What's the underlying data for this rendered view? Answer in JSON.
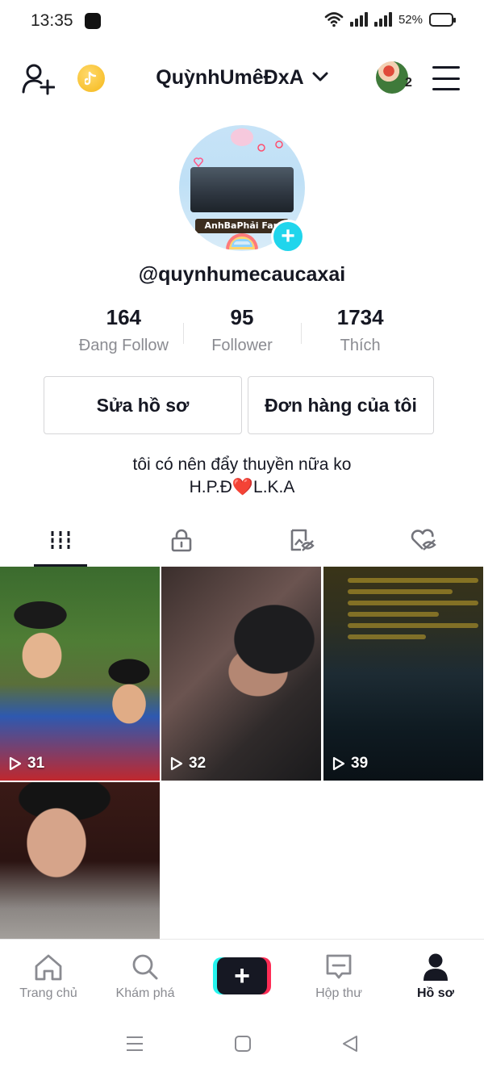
{
  "status_bar": {
    "time": "13:35",
    "battery_text": "52%",
    "battery_level": 0.52,
    "icons": [
      "app-notification-icon",
      "wifi-icon",
      "signal-icon",
      "signal-icon",
      "battery-icon"
    ]
  },
  "top_nav": {
    "username": "QuỳnhUmêĐxA",
    "friend_avatar_count": "2",
    "icons": [
      "add-friend-icon",
      "coin-icon",
      "chevron-down-icon",
      "friend-avatar",
      "menu-icon"
    ]
  },
  "profile": {
    "handle": "@quynhumecaucaxai",
    "avatar_banner_text": "AnhBaPhải Fan",
    "stats": [
      {
        "value": "164",
        "label": "Đang Follow"
      },
      {
        "value": "95",
        "label": "Follower"
      },
      {
        "value": "1734",
        "label": "Thích"
      }
    ],
    "buttons": {
      "edit_profile": "Sửa hồ sơ",
      "my_orders": "Đơn hàng của tôi"
    },
    "bio_line1": "tôi có nên đẩy thuyền nữa ko",
    "bio_line2": "H.P.Đ❤️L.K.A"
  },
  "content_tabs": [
    "grid-icon",
    "lock-icon",
    "tagged-hidden-icon",
    "liked-hidden-icon"
  ],
  "videos": [
    {
      "views": "31"
    },
    {
      "views": "32"
    },
    {
      "views": "39"
    },
    {
      "views": ""
    }
  ],
  "bottom_nav": [
    {
      "label": "Trang chủ",
      "icon": "home-icon"
    },
    {
      "label": "Khám phá",
      "icon": "search-icon"
    },
    {
      "label": "",
      "icon": "create-icon"
    },
    {
      "label": "Hộp thư",
      "icon": "inbox-icon"
    },
    {
      "label": "Hồ sơ",
      "icon": "profile-icon",
      "active": true
    }
  ],
  "colors": {
    "accent_cyan": "#25f4ee",
    "accent_pink": "#fe2c55",
    "text_primary": "#161823",
    "text_secondary": "#8a8b91"
  }
}
